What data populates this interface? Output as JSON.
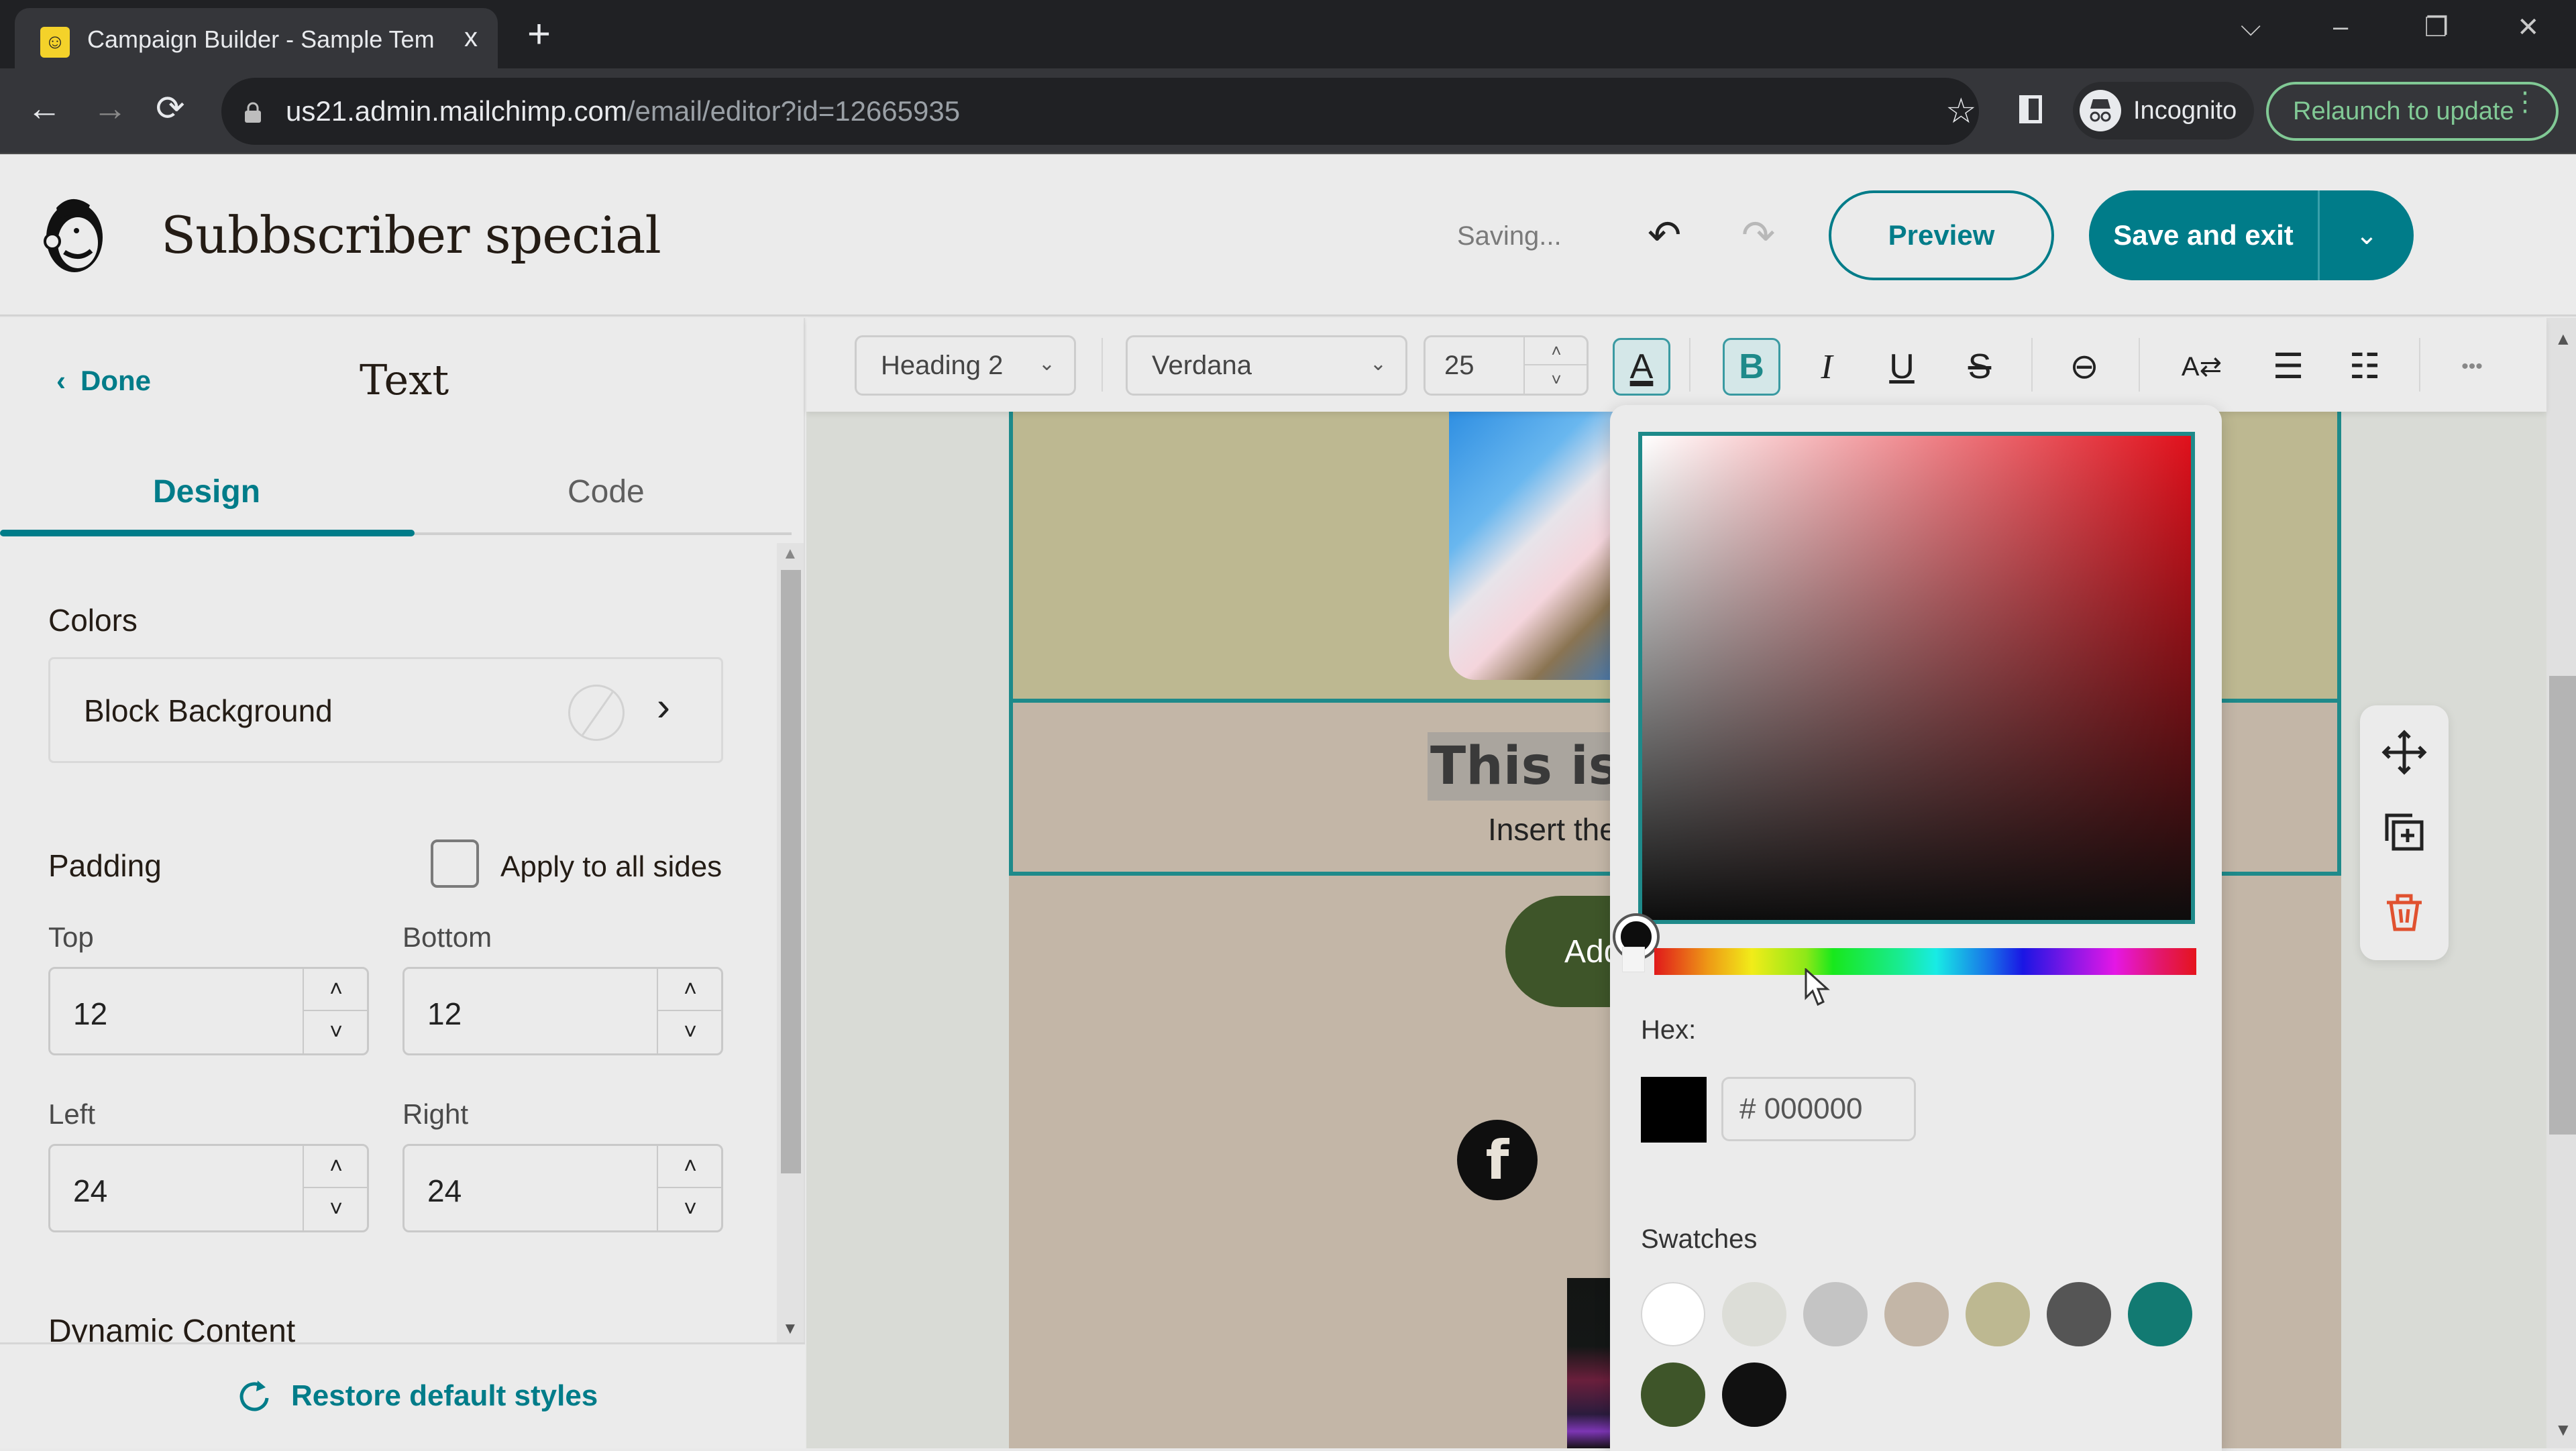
{
  "browser": {
    "tab_title": "Campaign Builder - Sample Tem",
    "tab_close": "x",
    "new_tab": "+",
    "url_host": "us21.admin.mailchimp.com",
    "url_path": "/email/editor?id=12665935",
    "incognito_label": "Incognito",
    "relaunch_label": "Relaunch to update",
    "window_controls": {
      "tab_search": "⌵",
      "minimize": "–",
      "restore": "❐",
      "close": "✕"
    },
    "nav": {
      "back": "←",
      "forward": "→",
      "reload": "⟳",
      "star": "☆"
    }
  },
  "header": {
    "campaign_title": "Subbscriber special",
    "status": "Saving...",
    "undo_icon": "↶",
    "redo_icon": "↷",
    "preview_label": "Preview",
    "save_label": "Save and exit",
    "save_dropdown_icon": "⌄"
  },
  "sidebar": {
    "done_label": "Done",
    "done_icon": "‹",
    "title": "Text",
    "tabs": [
      {
        "label": "Design",
        "active": true
      },
      {
        "label": "Code",
        "active": false
      }
    ],
    "colors": {
      "section_label": "Colors",
      "block_background_label": "Block Background",
      "block_background_value": "none",
      "chevron": "›"
    },
    "padding": {
      "section_label": "Padding",
      "apply_all_label": "Apply to all sides",
      "apply_all_checked": false,
      "fields": [
        {
          "label": "Top",
          "value": "12"
        },
        {
          "label": "Bottom",
          "value": "12"
        },
        {
          "label": "Left",
          "value": "24"
        },
        {
          "label": "Right",
          "value": "24"
        }
      ]
    },
    "dynamic_content_label": "Dynamic Content",
    "restore_label": "Restore default styles",
    "stepper_up": "˄",
    "stepper_down": "˅"
  },
  "toolbar": {
    "block_style": "Heading 2",
    "font_family": "Verdana",
    "font_size": "25",
    "caret": "⌄",
    "buttons": {
      "text_color": "A",
      "bold": "B",
      "italic": "I",
      "underline": "U",
      "strikethrough": "S",
      "link": "⊖",
      "text_direction": "A⇄",
      "bulleted_list": "☰",
      "numbered_list": "☷",
      "more": "•••"
    },
    "active": [
      "text_color",
      "bold"
    ]
  },
  "canvas": {
    "heading_text": "This is",
    "body_text": "Insert the",
    "cta_label": "Add",
    "facebook_icon": "f",
    "colors": {
      "hero_bg": "#bdb891",
      "text_block_bg": "#c3b6a7",
      "cta_bg": "#3e5529",
      "selection_border": "#1e8a8a"
    }
  },
  "color_picker": {
    "hue": "red",
    "hex_label": "Hex:",
    "hex_value": "# 000000",
    "current_color": "#000000",
    "swatches_label": "Swatches",
    "swatches": [
      "#ffffff",
      "#dcddd7",
      "#c4c4c4",
      "#c3b6a7",
      "#bdb891",
      "#555555",
      "#127a72",
      "#3e5529",
      "#111111"
    ]
  },
  "theme": {
    "accent": "#007c89"
  }
}
